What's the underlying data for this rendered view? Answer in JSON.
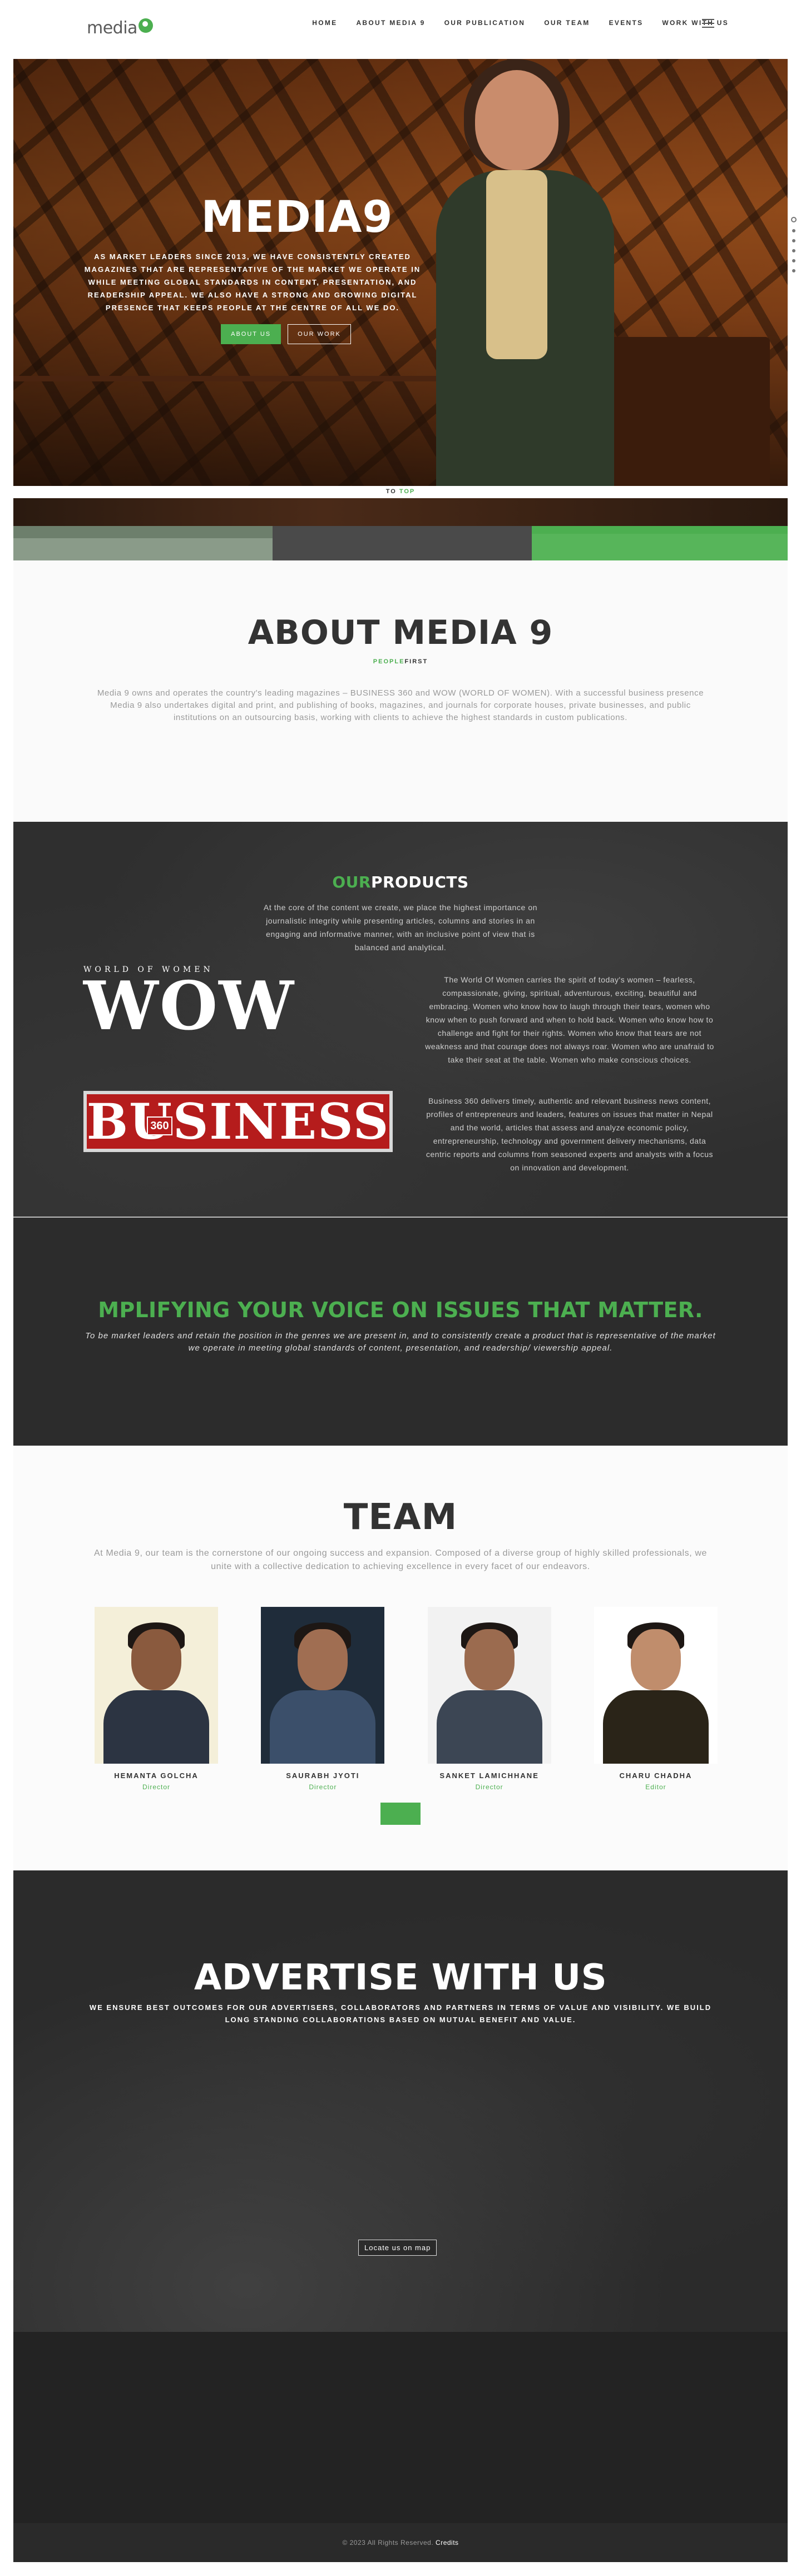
{
  "nav": {
    "logo_text": "media",
    "links": [
      "HOME",
      "ABOUT MEDIA 9",
      "OUR PUBLICATION",
      "OUR TEAM",
      "EVENTS",
      "WORK WITH US"
    ]
  },
  "hero": {
    "title": "MEDIA9",
    "text": "AS MARKET LEADERS SINCE 2013, WE HAVE CONSISTENTLY CREATED MAGAZINES THAT ARE REPRESENTATIVE OF THE MARKET WE OPERATE IN WHILE MEETING GLOBAL STANDARDS IN CONTENT, PRESENTATION, AND READERSHIP APPEAL. WE ALSO HAVE A STRONG AND GROWING DIGITAL PRESENCE THAT KEEPS PEOPLE AT THE CENTRE OF ALL WE DO.",
    "btn_about": "ABOUT US",
    "btn_work": "OUR WORK"
  },
  "to_top": {
    "part1": "TO ",
    "part2": "TOP"
  },
  "about": {
    "title": "ABOUT MEDIA 9",
    "tag_green": "PEOPLE",
    "tag_dark": "FIRST",
    "text": "Media 9 owns and operates the country's leading magazines – BUSINESS 360 and WOW (WORLD OF WOMEN). With a successful business presence Media 9 also undertakes digital and print, and publishing of books, magazines, and journals for corporate houses, private businesses, and public institutions on an outsourcing basis, working with clients to achieve the highest standards in custom publications."
  },
  "products": {
    "title_green": "OUR",
    "title_white": "PRODUCTS",
    "intro": "At the core of the content we create, we place the highest importance on journalistic integrity while presenting articles, columns and stories in an engaging and informative manner, with an inclusive point of view that is balanced and analytical.",
    "wow_sub": "WORLD OF WOMEN",
    "wow_logo": "WOW",
    "wow_text": "The World Of Women carries the spirit of today's women – fearless, compassionate, giving, spiritual, adventurous, exciting, beautiful and embracing. Women who know how to laugh through their tears, women who know when to push forward and when to hold back. Women who know how to challenge and fight for their rights. Women who know that tears are not weakness and that courage does not always roar. Women who are unafraid to take their seat at the table. Women who make conscious choices.",
    "biz_logo": "BUSINESS",
    "biz_360": "360",
    "biz_text": "Business 360 delivers timely, authentic and relevant business news content, profiles of entrepreneurs and leaders, features on issues that matter in Nepal and the world, articles that assess and analyze economic policy, entrepreneurship, technology and government delivery mechanisms, data centric reports and columns from seasoned experts and analysts with a focus on innovation and development."
  },
  "voice": {
    "title": "MPLIFYING YOUR VOICE ON ISSUES THAT MATTER.",
    "text": "To be market leaders and retain the position in the genres we are present in, and to consistently create a product that is representative of the market we operate in meeting global standards of content, presentation, and readership/ viewership appeal."
  },
  "team": {
    "title": "TEAM",
    "text": "At Media 9, our team is the cornerstone of our ongoing success and expansion. Composed of a diverse group of highly skilled professionals, we unite with a collective dedication to achieving excellence in every facet of our endeavors.",
    "members": [
      {
        "name": "HEMANTA GOLCHA",
        "role": "Director",
        "bg": "#f4efd9",
        "body": "#2c3442",
        "skin": "#8a5a3e"
      },
      {
        "name": "SAURABH JYOTI",
        "role": "Director",
        "bg": "#1f2c3a",
        "body": "#3b4f6a",
        "skin": "#a06e52"
      },
      {
        "name": "SANKET LAMICHHANE",
        "role": "Director",
        "bg": "#f2f2f2",
        "body": "#3c4654",
        "skin": "#9b6b4f"
      },
      {
        "name": "CHARU CHADHA",
        "role": "Editor",
        "bg": "#ffffff",
        "body": "#2a2418",
        "skin": "#c08d6c"
      }
    ]
  },
  "advertise": {
    "title": "ADVERTISE WITH US",
    "text": "WE ENSURE BEST OUTCOMES FOR OUR ADVERTISERS, COLLABORATORS AND PARTNERS IN TERMS OF VALUE AND VISIBILITY. WE BUILD LONG STANDING COLLABORATIONS BASED ON MUTUAL BENEFIT AND VALUE.",
    "map_button": "Locate us on map"
  },
  "footer": {
    "text": "© 2023 All Rights Reserved. ",
    "credits": "Credits"
  },
  "colors": {
    "accent": "#4caf50",
    "dark": "#2f2f2f",
    "brand_red": "#b51c1c"
  }
}
